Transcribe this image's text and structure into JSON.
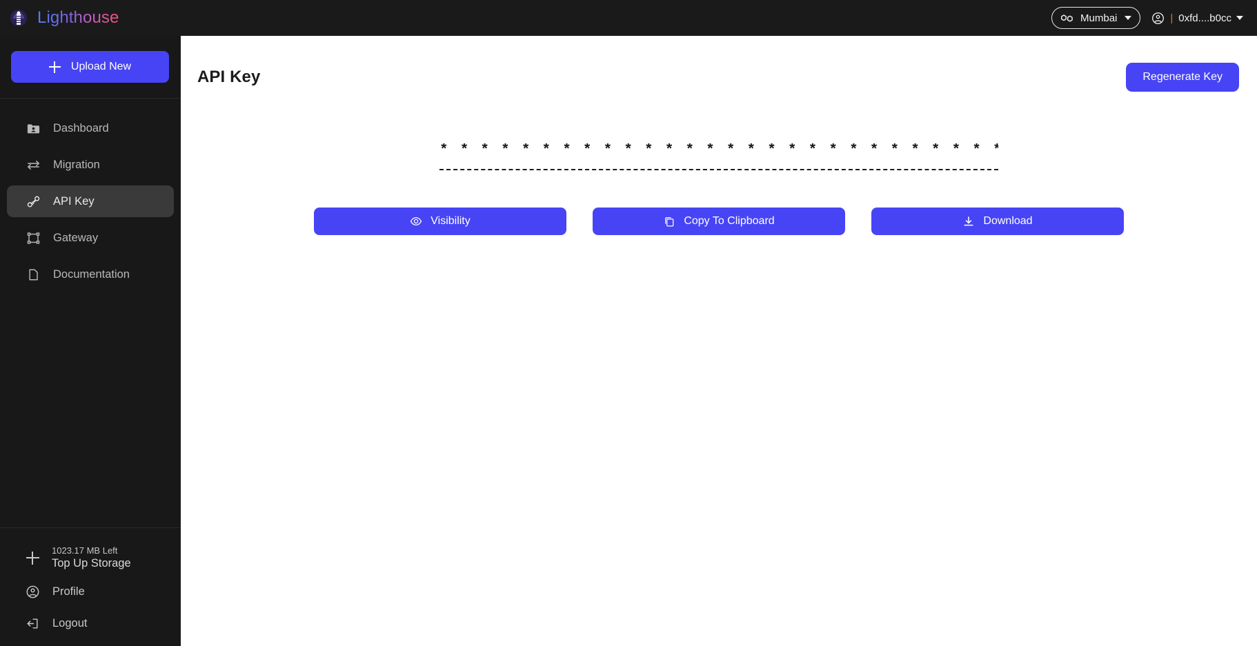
{
  "brand": {
    "name": "Lighthouse",
    "logo_icon": "lighthouse-icon",
    "gradient_start": "#4f7dfb",
    "gradient_end": "#f0527a"
  },
  "topbar": {
    "network": {
      "label": "Mumbai",
      "icon": "polygon-icon",
      "caret_icon": "chevron-down-icon"
    },
    "account": {
      "icon": "user-circle-icon",
      "divider": "|",
      "divider_color": "#e2761b",
      "address": "0xfd....b0cc",
      "caret_icon": "chevron-down-icon"
    },
    "background": "#1a1a1a"
  },
  "sidebar": {
    "upload_label": "Upload New",
    "upload_icon": "plus-icon",
    "accent": "#4744f5",
    "background": "#181818",
    "items": [
      {
        "label": "Dashboard",
        "icon": "folder-user-icon",
        "active": false
      },
      {
        "label": "Migration",
        "icon": "transfer-arrows-icon",
        "active": false
      },
      {
        "label": "API Key",
        "icon": "key-icon",
        "active": true
      },
      {
        "label": "Gateway",
        "icon": "frame-icon",
        "active": false
      },
      {
        "label": "Documentation",
        "icon": "document-icon",
        "active": false
      }
    ],
    "storage": {
      "icon": "plus-icon",
      "left": "1023.17 MB Left",
      "action": "Top Up Storage"
    },
    "profile": {
      "label": "Profile",
      "icon": "user-circle-icon"
    },
    "logout": {
      "label": "Logout",
      "icon": "logout-icon"
    }
  },
  "main": {
    "title": "API Key",
    "regenerate_label": "Regenerate Key",
    "api_key_masked": "* * * * * * * * * * * * * * * * * * * * * * * * * * * * * * * * * * * *",
    "actions": [
      {
        "label": "Visibility",
        "icon": "eye-icon"
      },
      {
        "label": "Copy To Clipboard",
        "icon": "copy-icon"
      },
      {
        "label": "Download",
        "icon": "download-icon"
      }
    ]
  }
}
